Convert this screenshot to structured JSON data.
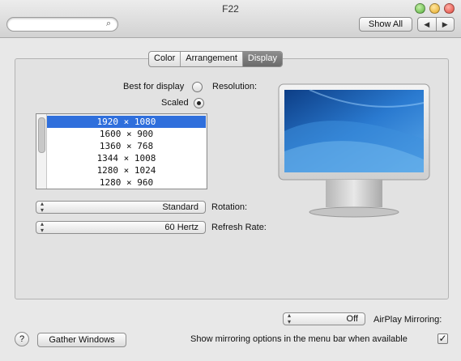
{
  "window": {
    "title": "F22"
  },
  "toolbar": {
    "show_all_label": "Show All",
    "back_icon": "◀",
    "forward_icon": "▶",
    "search_placeholder": "",
    "search_icon": "⌕"
  },
  "tabs": [
    {
      "label": "Color",
      "selected": false
    },
    {
      "label": "Arrangement",
      "selected": false
    },
    {
      "label": "Display",
      "selected": true
    }
  ],
  "resolution": {
    "label": "Resolution:",
    "options": [
      {
        "label": "Best for display",
        "selected": false
      },
      {
        "label": "Scaled",
        "selected": true
      }
    ],
    "list": [
      "1920 × 1080",
      "1600 × 900",
      "1360 × 768",
      "1344 × 1008",
      "1280 × 1024",
      "1280 × 960"
    ],
    "selected_index": 0
  },
  "rotation": {
    "label": "Rotation:",
    "value": "Standard"
  },
  "refresh_rate": {
    "label": "Refresh Rate:",
    "value": "60 Hertz"
  },
  "airplay": {
    "label": "AirPlay Mirroring:",
    "value": "Off"
  },
  "mirroring_checkbox": {
    "label": "Show mirroring options in the menu bar when available",
    "checked": true
  },
  "gather_windows_label": "Gather Windows",
  "help_label": "?"
}
